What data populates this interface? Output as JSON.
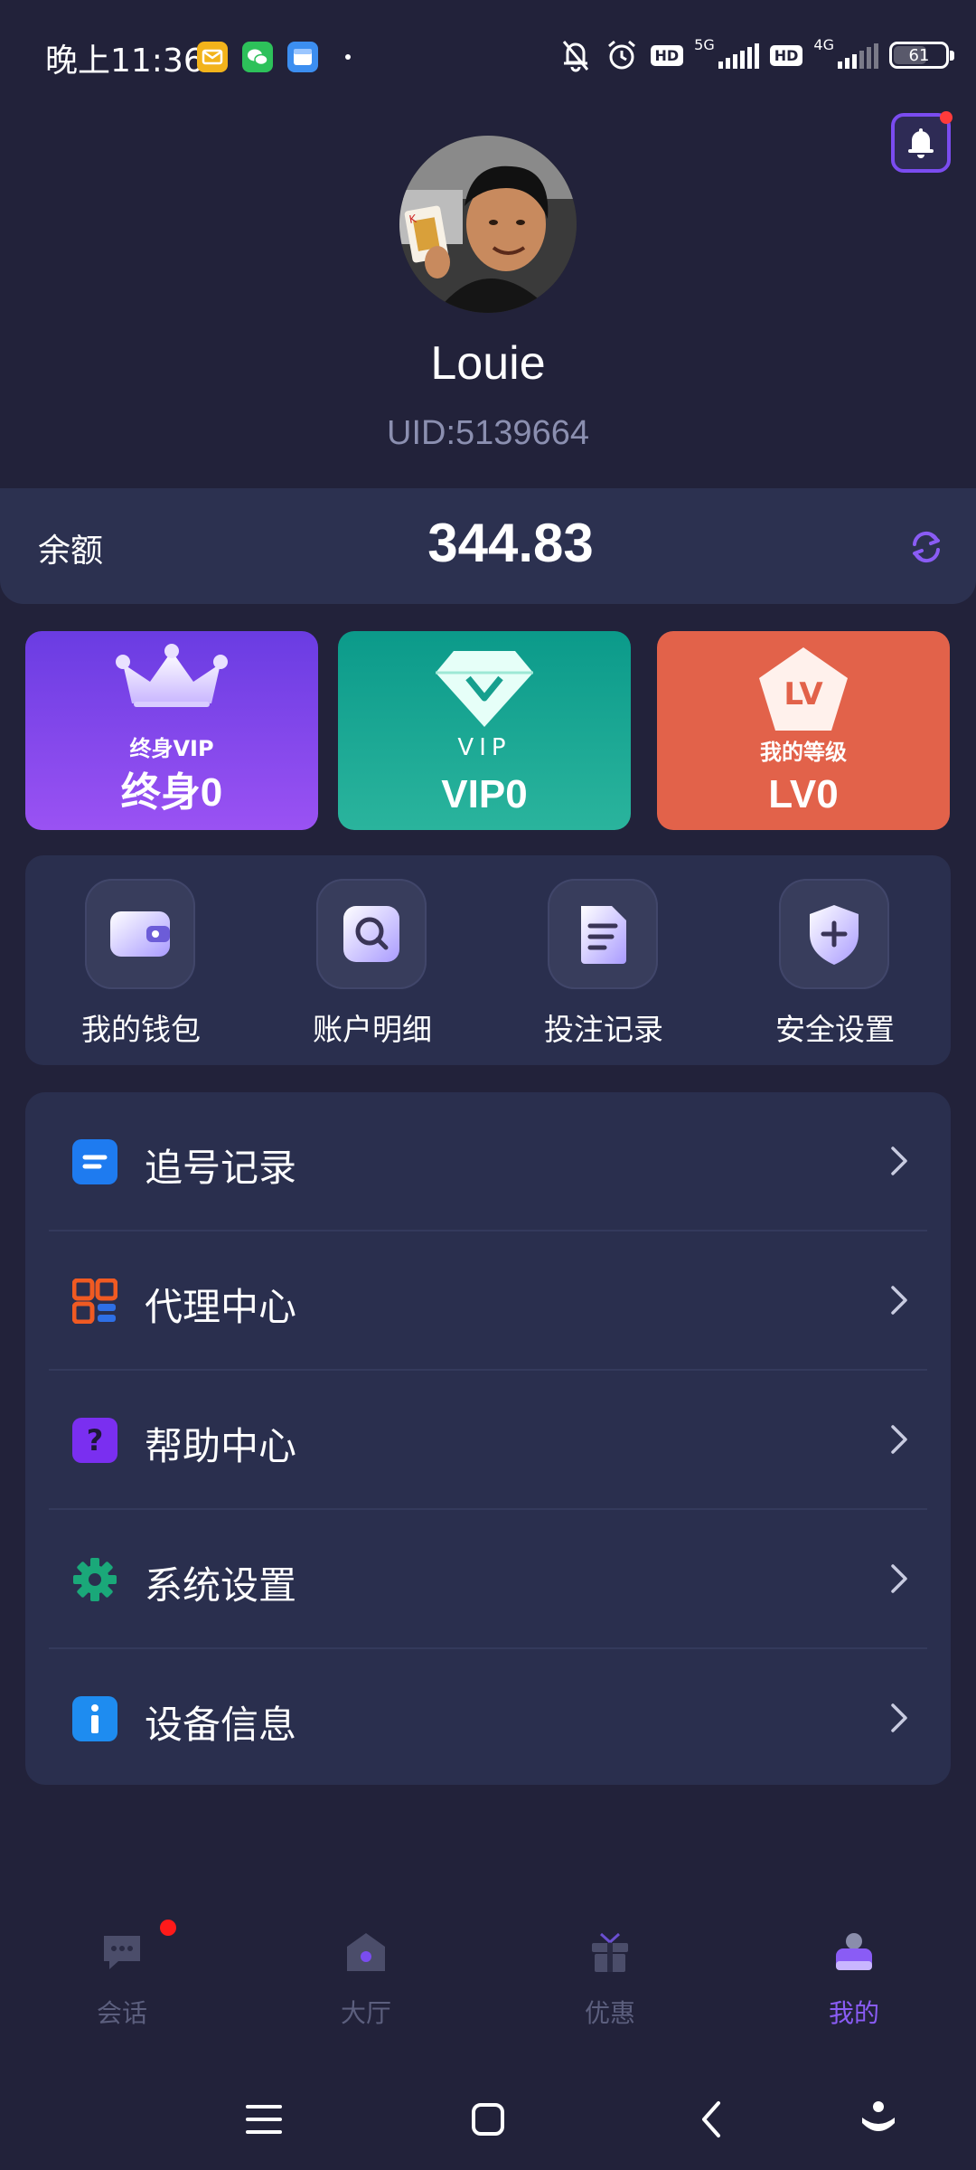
{
  "status_bar": {
    "time": "晚上11:36",
    "net_1": "5G",
    "net_2": "4G",
    "hd_1": "HD",
    "hd_2": "HD",
    "battery": "61",
    "icons": [
      "mail-app-icon",
      "wechat-icon",
      "calendar-app-icon",
      "dot-icon",
      "bell-mute-icon",
      "alarm-icon",
      "signal-icon",
      "battery-icon"
    ]
  },
  "profile": {
    "username": "Louie",
    "uid": "UID:5139664",
    "has_notification": true
  },
  "balance": {
    "label": "余额",
    "value": "344.83"
  },
  "cards": [
    {
      "emblem_text": "终身VIP",
      "value": "终身0",
      "color": "#7b45ea"
    },
    {
      "emblem_text": "VIP",
      "value": "VIP0",
      "color": "#169f8e"
    },
    {
      "emblem_text": "我的等级",
      "badge": "LV",
      "value": "LV0",
      "color": "#e2624a"
    }
  ],
  "quick_actions": [
    {
      "label": "我的钱包",
      "icon": "wallet-icon"
    },
    {
      "label": "账户明细",
      "icon": "search-icon"
    },
    {
      "label": "投注记录",
      "icon": "document-icon"
    },
    {
      "label": "安全设置",
      "icon": "shield-icon"
    }
  ],
  "menu": [
    {
      "label": "追号记录",
      "icon": "list-icon",
      "color": "#1e7bf0"
    },
    {
      "label": "代理中心",
      "icon": "grid-icon",
      "color": "#f05a22"
    },
    {
      "label": "帮助中心",
      "icon": "question-icon",
      "color": "#7a2ff0"
    },
    {
      "label": "系统设置",
      "icon": "gear-icon",
      "color": "#1aa879"
    },
    {
      "label": "设备信息",
      "icon": "info-icon",
      "color": "#1e8cf0"
    }
  ],
  "tabs": [
    {
      "label": "会话",
      "icon": "chat-icon",
      "active": false,
      "badge": true
    },
    {
      "label": "大厅",
      "icon": "home-icon",
      "active": false
    },
    {
      "label": "优惠",
      "icon": "gift-icon",
      "active": false
    },
    {
      "label": "我的",
      "icon": "profile-icon",
      "active": true
    }
  ],
  "accent_color": "#8a5cf5"
}
